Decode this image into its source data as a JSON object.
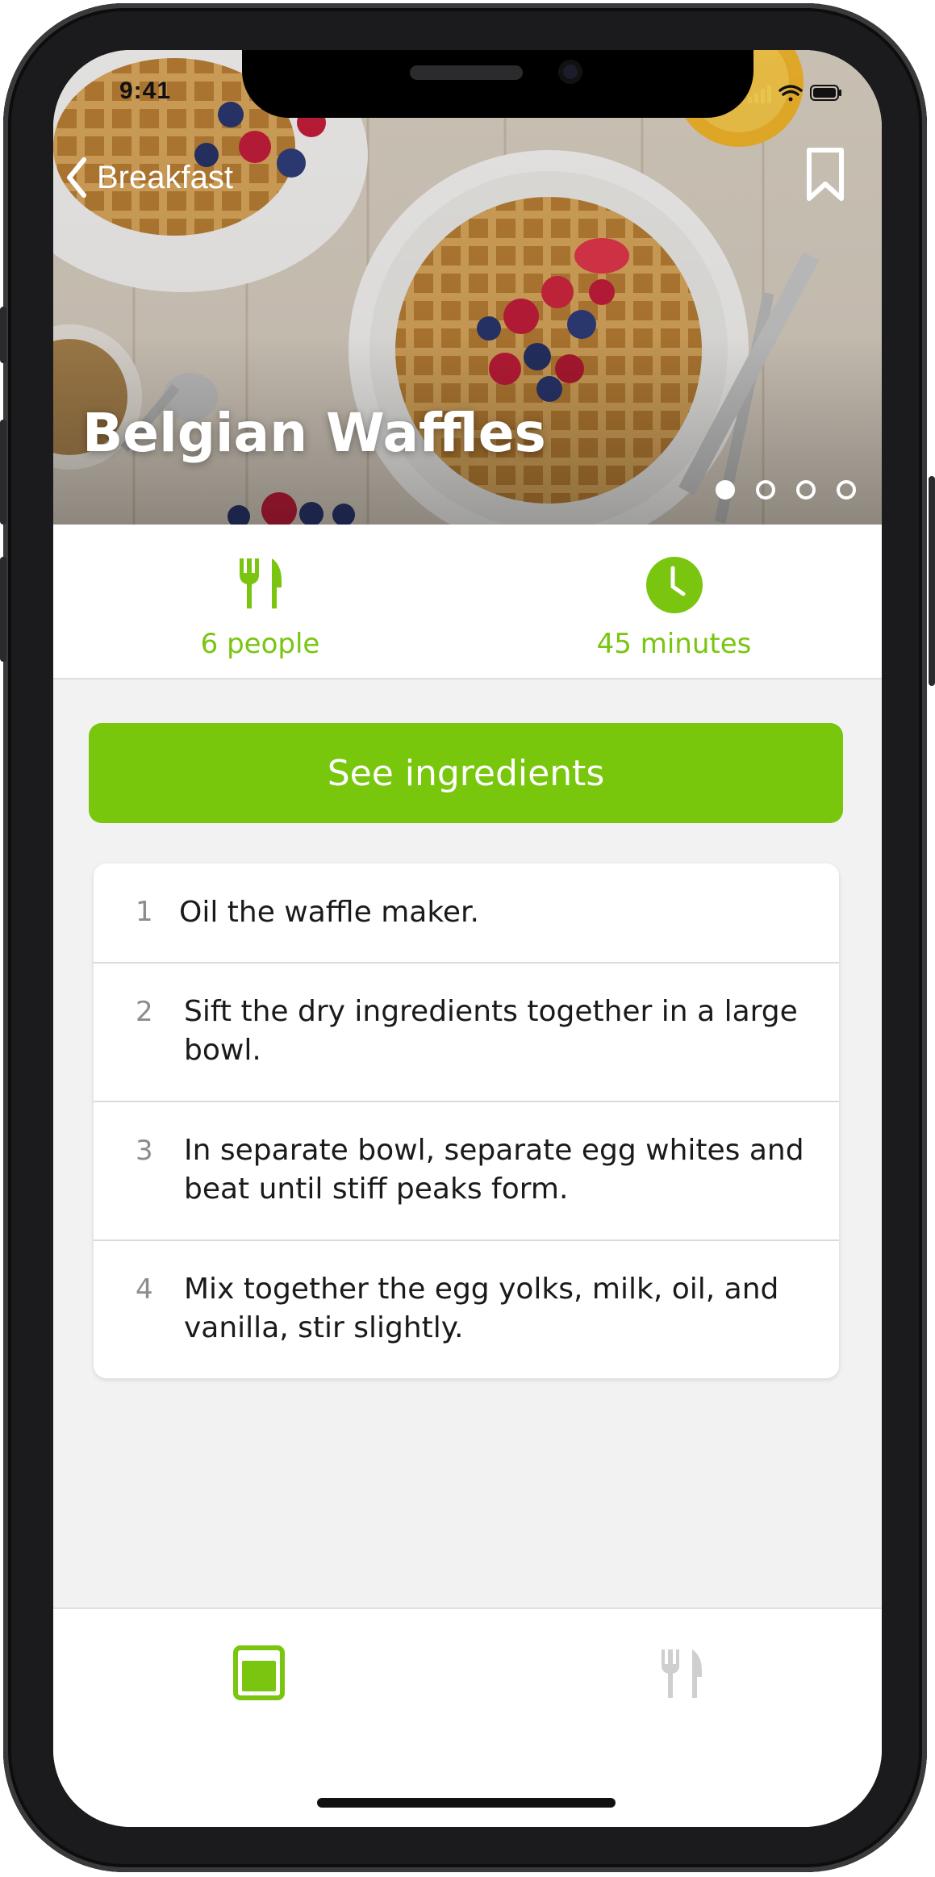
{
  "status_bar": {
    "time": "9:41"
  },
  "nav": {
    "back_label": "Breakfast"
  },
  "hero": {
    "title": "Belgian Waffles",
    "pages": 4,
    "active_page": 1
  },
  "info": {
    "servings": "6 people",
    "duration": "45 minutes"
  },
  "cta": {
    "label": "See ingredients"
  },
  "steps": [
    {
      "num": "1",
      "text": "Oil the waffle maker."
    },
    {
      "num": "2",
      "text": "Sift the dry ingredients together in a large bowl."
    },
    {
      "num": "3",
      "text": "In separate bowl, separate egg whites and beat until stiff peaks form."
    },
    {
      "num": "4",
      "text": "Mix together the egg yolks, milk, oil, and vanilla, stir slightly."
    }
  ],
  "tabs": [
    {
      "icon": "recipe-book-icon",
      "active": true
    },
    {
      "icon": "fork-knife-icon",
      "active": false
    }
  ],
  "colors": {
    "accent": "#78c70d",
    "background": "#f2f2f3"
  }
}
